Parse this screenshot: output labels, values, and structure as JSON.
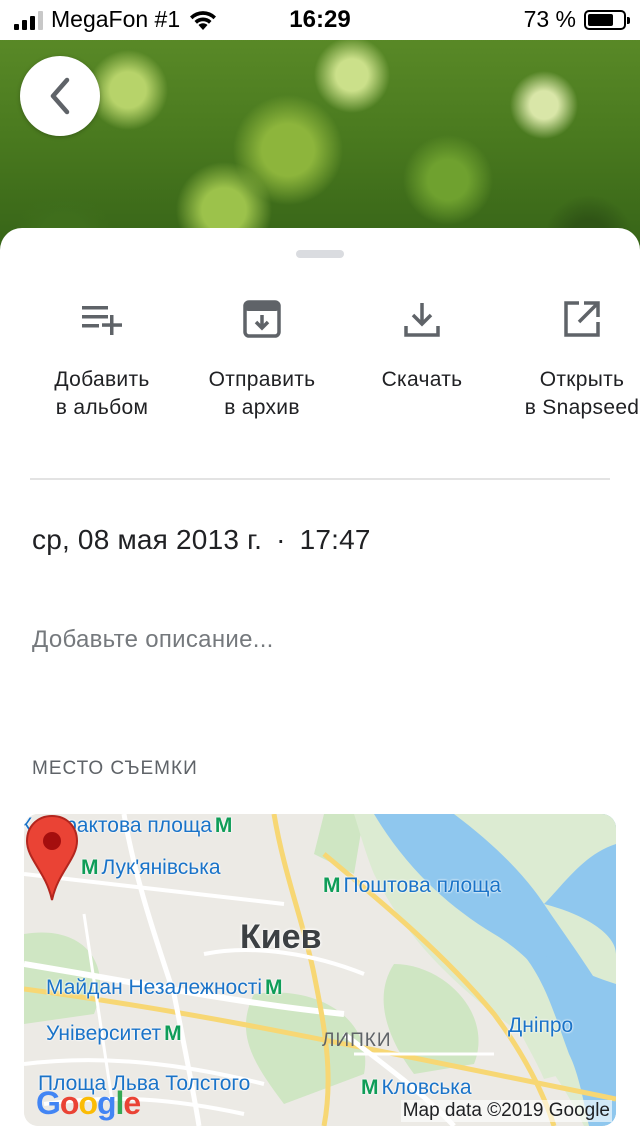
{
  "status_bar": {
    "carrier": "MegaFon #1",
    "time": "16:29",
    "battery_percent": "73 %",
    "battery_level": 0.73
  },
  "back_button": {
    "icon": "chevron-left-icon"
  },
  "actions": [
    {
      "line1": "Добавить",
      "line2": "в альбом",
      "icon": "playlist-add-icon"
    },
    {
      "line1": "Отправить",
      "line2": "в архив",
      "icon": "archive-icon"
    },
    {
      "line1": "Скачать",
      "line2": "",
      "icon": "download-icon"
    },
    {
      "line1": "Открыть",
      "line2": "в Snapseed",
      "icon": "open-external-icon"
    }
  ],
  "details": {
    "date": "ср, 08 мая 2013 г.",
    "separator": "·",
    "time": "17:47",
    "description_placeholder": "Добавьте описание..."
  },
  "location": {
    "label": "МЕСТО СЪЕМКИ",
    "city": "Киев",
    "district": "ЛИПКИ",
    "stations": [
      "Контрактова площа",
      "Лук'янівська",
      "Поштова площа",
      "Майдан Незалежності",
      "Університет",
      "Дніпро",
      "Площа Льва Толстого",
      "Кловська"
    ],
    "metro_symbol": "M",
    "map_copyright": "Map data ©2019 Google",
    "logo": "Google"
  },
  "colors": {
    "accent_blue": "#1a73c8",
    "pin_red": "#ea4335",
    "metro_green": "#0f9d58",
    "river": "#8fc7ee"
  }
}
